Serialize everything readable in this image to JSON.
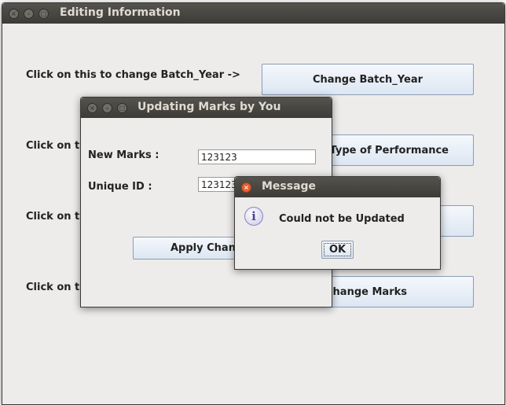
{
  "main_window": {
    "title": "Editing Information",
    "rows": [
      {
        "label": "Click on this to change Batch_Year ->",
        "button": "Change Batch_Year"
      },
      {
        "label": "Click on th",
        "button": "Type of Performance"
      },
      {
        "label": "Click on th",
        "button": ""
      },
      {
        "label": "Click on th",
        "button": "Change Marks"
      }
    ]
  },
  "update_dialog": {
    "title": "Updating Marks by You",
    "new_marks_label": "New Marks :",
    "new_marks_value": "123123",
    "unique_id_label": "Unique ID :",
    "unique_id_value": "123123",
    "apply_button": "Apply Chang"
  },
  "message_dialog": {
    "title": "Message",
    "icon": "info-icon",
    "message": "Could not be Updated",
    "ok_button": "OK"
  },
  "colors": {
    "titlebar": "#3c3b37",
    "close_button": "#e85e2f",
    "window_bg": "#edeceb",
    "button_border": "#8a9cb4"
  }
}
